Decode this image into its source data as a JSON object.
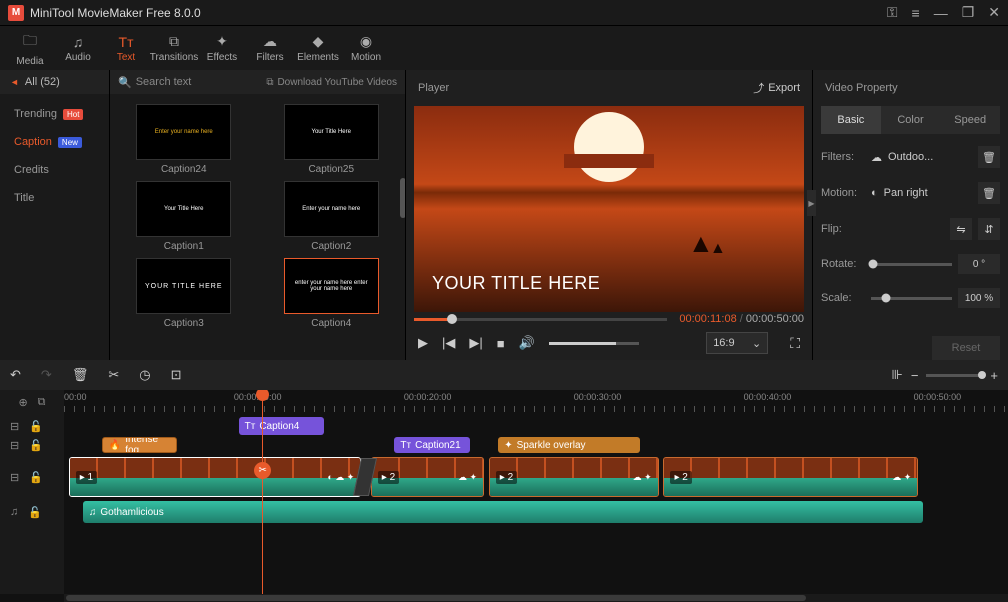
{
  "app": {
    "title": "MiniTool MovieMaker Free 8.0.0",
    "logo_letter": "M"
  },
  "menubar": {
    "tabs": [
      {
        "label": "Media",
        "icon": "folder"
      },
      {
        "label": "Audio",
        "icon": "audio"
      },
      {
        "label": "Text",
        "icon": "text",
        "active": true
      },
      {
        "label": "Transitions",
        "icon": "trans"
      },
      {
        "label": "Effects",
        "icon": "fx"
      },
      {
        "label": "Filters",
        "icon": "filter"
      },
      {
        "label": "Elements",
        "icon": "elem"
      },
      {
        "label": "Motion",
        "icon": "motion"
      }
    ]
  },
  "categories": {
    "header": "All (52)",
    "items": [
      {
        "label": "Trending",
        "badge": "Hot",
        "badge_cls": "hot"
      },
      {
        "label": "Caption",
        "badge": "New",
        "badge_cls": "new",
        "active": true
      },
      {
        "label": "Credits"
      },
      {
        "label": "Title"
      }
    ]
  },
  "browser": {
    "search_placeholder": "Search text",
    "download_label": "Download YouTube Videos",
    "thumbs": [
      {
        "label": "Caption24",
        "preview": "Enter your name here"
      },
      {
        "label": "Caption25",
        "preview": "Your Title Here"
      },
      {
        "label": "Caption1",
        "preview": "Your Title Here"
      },
      {
        "label": "Caption2",
        "preview": "Enter your name here"
      },
      {
        "label": "Caption3",
        "preview": "YOUR TITLE HERE"
      },
      {
        "label": "Caption4",
        "preview": "enter your name here enter your name here",
        "selected": true
      }
    ]
  },
  "player": {
    "title": "Player",
    "export": "Export",
    "overlay_text": "YOUR TITLE HERE",
    "time_current": "00:00:11:08",
    "time_total": "00:00:50:00",
    "ratio": "16:9"
  },
  "props": {
    "title": "Video Property",
    "tabs": [
      "Basic",
      "Color",
      "Speed"
    ],
    "filters_label": "Filters:",
    "filters_value": "Outdoo...",
    "motion_label": "Motion:",
    "motion_value": "Pan right",
    "flip_label": "Flip:",
    "rotate_label": "Rotate:",
    "rotate_value": "0 °",
    "scale_label": "Scale:",
    "scale_value": "100 %",
    "reset": "Reset"
  },
  "timeline": {
    "marks": [
      "00:00",
      "00:00:10:00",
      "00:00:20:00",
      "00:00:30:00",
      "00:00:40:00",
      "00:00:50:00"
    ],
    "playhead_pct": 21,
    "clips": {
      "caption4": "Caption4",
      "caption21": "Caption21",
      "fog": "Intense fog",
      "spark": "Sparkle overlay",
      "v1": "1",
      "v2": "2",
      "v3": "2",
      "v4": "2",
      "audio": "Gothamlicious"
    }
  }
}
